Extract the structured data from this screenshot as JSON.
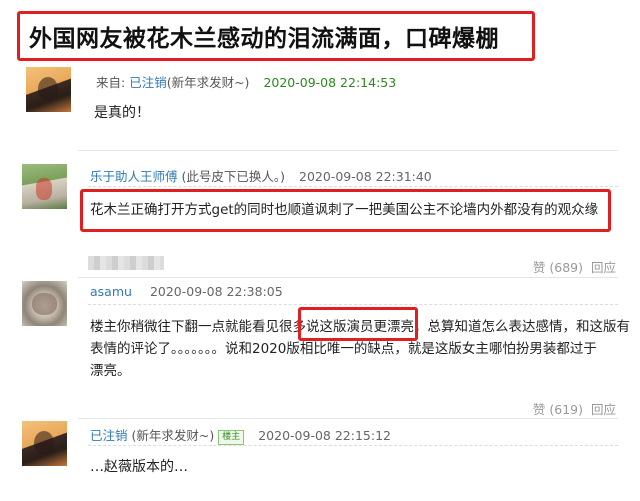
{
  "headline": "外国网友被花木兰感动的泪流满面，口碑爆棚",
  "comments": [
    {
      "prefix": "来自: ",
      "name": "已注销",
      "suffix": "(新年求发财~)",
      "time": "2020-09-08 22:14:53",
      "text": "是真的！"
    },
    {
      "name": "乐于助人王师傅",
      "suffix": " (此号皮下已换人。)",
      "time": "2020-09-08 22:31:40",
      "text": "花木兰正确打开方式get的同时也顺道讽刺了一把美国公主不论墙内外都没有的观众缘",
      "likes": "赞 (689)",
      "reply": "回应"
    },
    {
      "name": "asamu",
      "time": "2020-09-08 22:38:05",
      "text_line1": "楼主你稍微往下翻一点就能看见很多说这版演员更漂亮，总算知道怎么表达感情，和这版有",
      "text_line2": "表情的评论了。。。。。。。说和2020版相比唯一的缺点，就是这版女主哪怕扮男装都过于",
      "text_line3": "漂亮。",
      "likes": "赞 (619)",
      "reply": "回应"
    },
    {
      "name": "已注销",
      "suffix": " (新年求发财~)",
      "badge": "楼主",
      "time": "2020-09-08 22:15:12",
      "text": "…赵薇版本的…"
    }
  ]
}
